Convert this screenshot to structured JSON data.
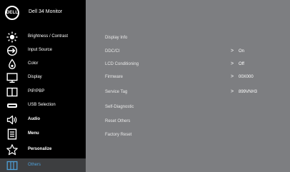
{
  "header": {
    "logo_text": "DELL",
    "model": "Dell 34 Monitor"
  },
  "sidebar": {
    "items": [
      {
        "label": "Brightness / Contrast",
        "icon": "brightness-icon"
      },
      {
        "label": "Input Source",
        "icon": "input-source-icon"
      },
      {
        "label": "Color",
        "icon": "color-icon"
      },
      {
        "label": "Display",
        "icon": "display-icon"
      },
      {
        "label": "PIP/PBP",
        "icon": "pip-pbp-icon"
      },
      {
        "label": "USB Selection",
        "icon": "usb-icon"
      },
      {
        "label": "Audio",
        "icon": "speaker-icon"
      },
      {
        "label": "Menu",
        "icon": "menu-icon"
      },
      {
        "label": "Personalize",
        "icon": "star-icon"
      },
      {
        "label": "Others",
        "icon": "others-icon"
      }
    ],
    "active_index": 9
  },
  "content": {
    "rows": [
      {
        "label": "Display Info",
        "value": ""
      },
      {
        "label": "DDC/CI",
        "value": "On"
      },
      {
        "label": "LCD Conditioning",
        "value": "Off"
      },
      {
        "label": "Firmware",
        "value": "00X000"
      },
      {
        "label": "Service Tag",
        "value": "899VNH3"
      },
      {
        "label": "Self-Diagnostic",
        "value": ""
      },
      {
        "label": "Reset Others",
        "value": ""
      },
      {
        "label": "Factory Reset",
        "value": ""
      }
    ],
    "arrow_glyph": ">"
  },
  "colors": {
    "sidebar_bg": "#000000",
    "content_bg": "#7d7e81",
    "active_bg": "#3d3e40",
    "active_text": "#4fa0d8"
  }
}
